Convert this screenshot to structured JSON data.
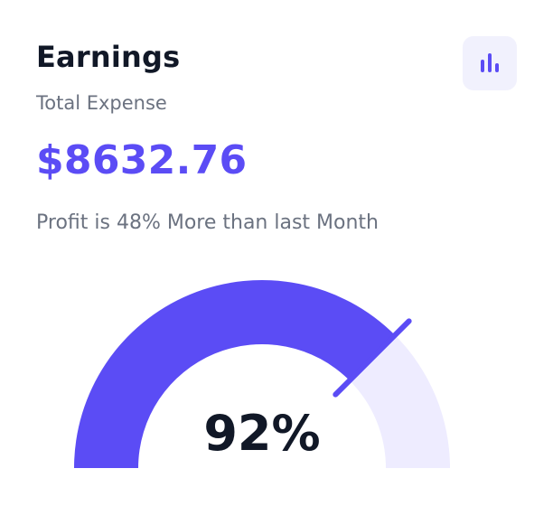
{
  "card": {
    "title": "Earnings",
    "subtitle": "Total Expense",
    "amount": "$8632.76",
    "note": "Profit is 48% More than last Month"
  },
  "icon_button": {
    "icon": "bar-chart-icon"
  },
  "gauge": {
    "percent_label": "92%",
    "value_fraction": 0.75,
    "fill_color": "#5b4cf5",
    "track_color": "#eeecff",
    "indicator_color": "#5b4cf5"
  }
}
